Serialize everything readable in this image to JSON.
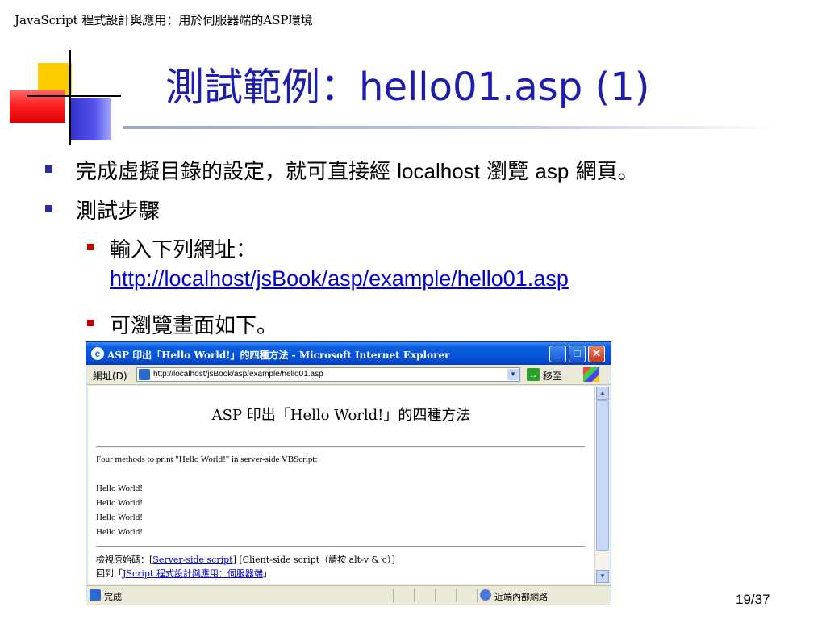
{
  "slide": {
    "header": "JavaScript 程式設計與應用：用於伺服器端的ASP環境",
    "title_cjk": "測試範例：",
    "title_latin": "hello01.asp (1)",
    "page_number": "19/37"
  },
  "bullets": {
    "b1_part1": "完成虛擬目錄的設定，就可直接經 ",
    "b1_localhost": "localhost",
    "b1_part2": " 瀏覽 ",
    "b1_asp": "asp",
    "b1_part3": " 網頁。",
    "b2": "測試步驟",
    "b2_1": "輸入下列網址：",
    "b2_1_url": "http://localhost/jsBook/asp/example/hello01.asp",
    "b2_2": "可瀏覽畫面如下。"
  },
  "browser": {
    "window_title": "ASP 印出「Hello World!」的四種方法 - Microsoft Internet Explorer",
    "address_label": "網址(D)",
    "address_value": "http://localhost/jsBook/asp/example/hello01.asp",
    "go_label": "移至",
    "status_text": "完成",
    "zone_text": "近端內部網路",
    "page": {
      "heading": "ASP 印出「Hello World!」的四種方法",
      "intro": "Four methods to print \"Hello World!\" in server-side VBScript:",
      "hello_lines": [
        "Hello World!",
        "Hello World!",
        "Hello World!",
        "Hello World!"
      ],
      "view_source_label": "檢視原始碼：",
      "server_script_link": "Server-side script",
      "client_script_text": "[Client-side script（請按 alt-v & c）]",
      "back_label": "回到「",
      "back_link": "JScript 程式設計與應用：伺服器端",
      "back_end": "」"
    }
  },
  "colors": {
    "title": "#1d1daf",
    "bullet_level1": "#2b2b9f",
    "bullet_level2": "#cc0000",
    "link": "#0000cc"
  },
  "icons": {
    "ie_icon": "e",
    "minimize": "_",
    "maximize": "□",
    "close": "✕",
    "go_arrow": "→",
    "dropdown": "▼",
    "scroll_up": "▲",
    "scroll_down": "▼"
  }
}
